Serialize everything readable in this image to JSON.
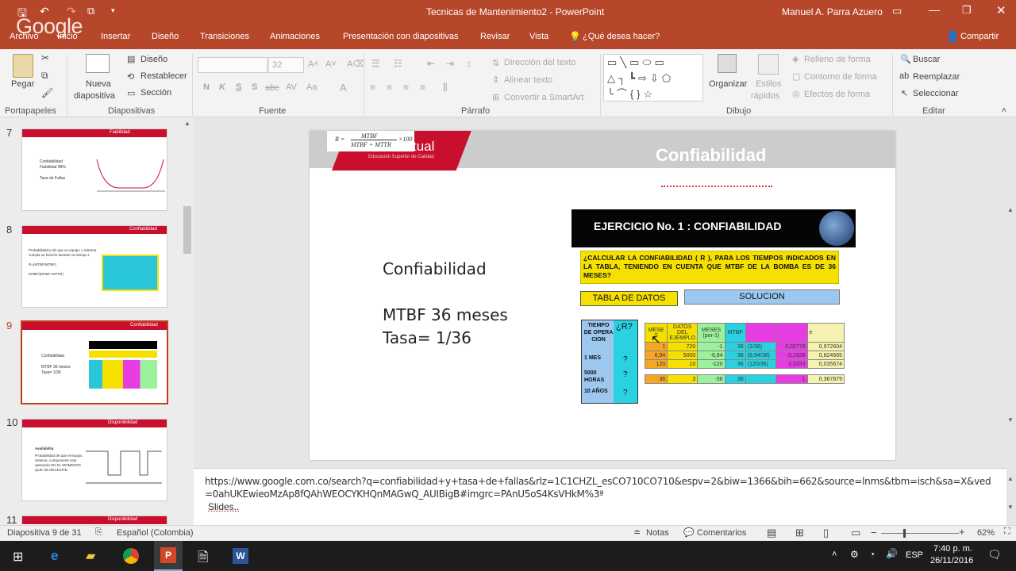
{
  "window": {
    "title": "Tecnicas de Mantenimiento2 - PowerPoint",
    "user": "Manuel A. Parra Azuero",
    "watermark": "Google"
  },
  "tabs": [
    "Archivo",
    "Inicio",
    "Insertar",
    "Diseño",
    "Transiciones",
    "Animaciones",
    "Presentación con diapositivas",
    "Revisar",
    "Vista"
  ],
  "tellme": "¿Qué desea hacer?",
  "share": "Compartir",
  "ribbon": {
    "paste": "Pegar",
    "new_slide_line1": "Nueva",
    "new_slide_line2": "diapositiva",
    "layout": "Diseño",
    "reset": "Restablecer",
    "section": "Sección",
    "font_size": "32",
    "font_buttons": [
      "N",
      "K",
      "S",
      "S",
      "abc",
      "AV",
      "Aa"
    ],
    "text_direction": "Dirección del texto",
    "align_text": "Alinear texto",
    "smartart": "Convertir a SmartArt",
    "arrange": "Organizar",
    "styles_line1": "Estilos",
    "styles_line2": "rápidos",
    "fill": "Relleno de forma",
    "outline": "Contorno de forma",
    "effects": "Efectos de forma",
    "find": "Buscar",
    "replace": "Reemplazar",
    "select": "Seleccionar",
    "groups": [
      "Portapapeles",
      "Diapositivas",
      "Fuente",
      "Párrafo",
      "Dibujo",
      "Editar"
    ]
  },
  "thumbnails": [
    {
      "num": "7",
      "header": "Fiabilidad",
      "lines": [
        "Confiabilidad",
        "Fiabilidad 98%",
        "",
        "Tasa de Fallas"
      ]
    },
    {
      "num": "8",
      "header": "Confiabilidad",
      "lines": [
        "Probabilidad p de que un equipo o sistema cumpla su función durante un tiempo t.",
        "",
        "R=(MTBF/MTBF)",
        "",
        "MTBF/(MTBF+MTTR)"
      ]
    },
    {
      "num": "9",
      "header": "Confiabilidad",
      "lines": [
        "Confiabilidad",
        "",
        "MTBF 36 meses",
        "Tasa= 1/36"
      ]
    },
    {
      "num": "10",
      "header": "Disponibilidad",
      "lines": [
        "Availability",
        "Probabilidad de que el equipo sistema, componente este operando EN EL MOMENTO QUE SE NECESITE."
      ]
    },
    {
      "num": "11",
      "header": "Disponibilidad",
      "lines": []
    }
  ],
  "slide": {
    "title": "Confiabilidad",
    "logo_text": "tual",
    "logo_sub": "Educación Superior de Calidad",
    "formula_num": "MTBF",
    "formula_den": "MTBF + MTTR",
    "formula_lhs": "R =",
    "formula_rhs": "×100",
    "body": [
      "Confiabilidad",
      "",
      "MTBF 36 meses",
      "Tasa= 1/36"
    ],
    "exercise": {
      "banner": "EJERCICIO No. 1 : CONFIABILIDAD",
      "question": "¿CALCULAR LA CONFIABILIDAD ( R ), PARA LOS TIEMPOS INDICADOS EN LA TABLA, TENIENDO EN CUENTA QUE MTBF DE LA BOMBA ES DE 36 MESES?",
      "data_btn": "TABLA DE DATOS",
      "solution_btn": "SOLUCION",
      "left_table": {
        "header": [
          "TIEMPO DE OPERA CION",
          "¿R?"
        ],
        "rows": [
          [
            "1 MES",
            "?"
          ],
          [
            "5000 HORAS",
            "?"
          ],
          [
            "10 AÑOS",
            "?"
          ]
        ]
      },
      "right_header": [
        "MESE S",
        "DATOS DEL EJEMPLO",
        "MESES (por-1)",
        "MTBF",
        "",
        "",
        "e"
      ],
      "right_rows": [
        [
          "1",
          "720",
          "-1",
          "36",
          "(1/36)",
          "0,02778",
          "0,972604"
        ],
        [
          "6,94",
          "5000",
          "-6,94",
          "36",
          "(6,94/36)",
          "0,1928",
          "0,824665"
        ],
        [
          "120",
          "10",
          "-120",
          "36",
          "(120/36)",
          "3,3333",
          "0,035674"
        ],
        [
          "36",
          "3",
          "-36",
          "36",
          "",
          "1",
          "0,367879"
        ]
      ]
    }
  },
  "notes": {
    "url": "https://www.google.com.co/search?q=confiabilidad+y+tasa+de+fallas&rlz=1C1CHZL_esCO710CO710&espv=2&biw=1366&bih=662&source=lnms&tbm=isch&sa=X&ved=0ahUKEwieoMzAp8fQAhWEOCYKHQnMAGwQ_AUIBigB#imgrc=PAnU5oS4KsVHkM%3ª",
    "footer": "Slides.."
  },
  "status": {
    "slide": "Diapositiva 9 de 31",
    "language": "Español (Colombia)",
    "notes": "Notas",
    "comments": "Comentarios",
    "zoom": "62%"
  },
  "taskbar": {
    "lang": "ESP",
    "time": "7:40 p. m.",
    "date": "26/11/2016"
  },
  "colors": {
    "accent": "#b7472a",
    "slide_red": "#c8102e",
    "selected": "#c43e1c"
  }
}
